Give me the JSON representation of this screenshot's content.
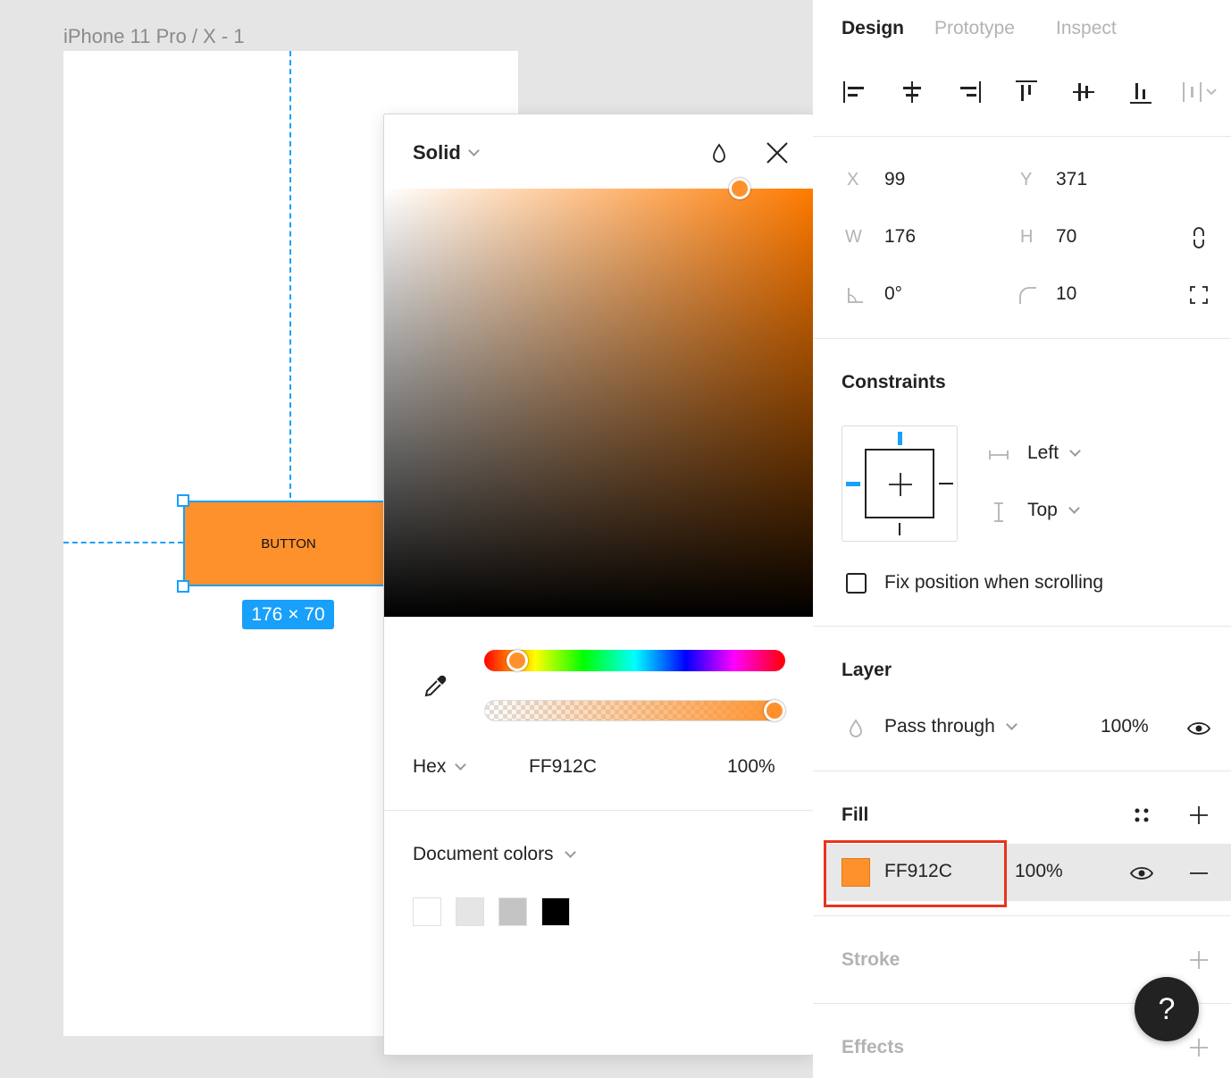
{
  "canvas": {
    "frame_label": "iPhone 11 Pro / X - 1",
    "button_label": "BUTTON",
    "size_badge": "176 × 70",
    "selection_color": "#18a0fb",
    "button_fill": "#ff912c"
  },
  "picker": {
    "fill_type": "Solid",
    "color_mode": "Hex",
    "hex_value": "FF912C",
    "opacity": "100%",
    "hue_fraction": 0.08,
    "alpha_fraction": 1.0,
    "document_colors_label": "Document colors",
    "document_colors": [
      "#ffffff",
      "#e5e5e5",
      "#c4c4c4",
      "#000000"
    ],
    "icons": [
      "style-drop-icon",
      "close-icon",
      "eyedropper-icon"
    ]
  },
  "panel": {
    "tabs": [
      {
        "label": "Design",
        "active": true
      },
      {
        "label": "Prototype",
        "active": false
      },
      {
        "label": "Inspect",
        "active": false
      }
    ],
    "align_icons": [
      "align-left-icon",
      "align-horizontal-center-icon",
      "align-right-icon",
      "align-top-icon",
      "align-vertical-center-icon",
      "align-bottom-icon",
      "distribute-icon"
    ],
    "props": {
      "x_label": "X",
      "x_value": "99",
      "y_label": "Y",
      "y_value": "371",
      "w_label": "W",
      "w_value": "176",
      "h_label": "H",
      "h_value": "70",
      "rotation_value": "0°",
      "radius_value": "10"
    },
    "constraints": {
      "title": "Constraints",
      "horizontal": "Left",
      "vertical": "Top",
      "fix_label": "Fix position when scrolling",
      "fix_checked": false
    },
    "layer": {
      "title": "Layer",
      "blend_mode": "Pass through",
      "opacity": "100%"
    },
    "fill": {
      "title": "Fill",
      "hex": "FF912C",
      "opacity": "100%",
      "color": "#ff912c"
    },
    "stroke": {
      "title": "Stroke"
    },
    "effects": {
      "title": "Effects"
    },
    "help_label": "?"
  }
}
